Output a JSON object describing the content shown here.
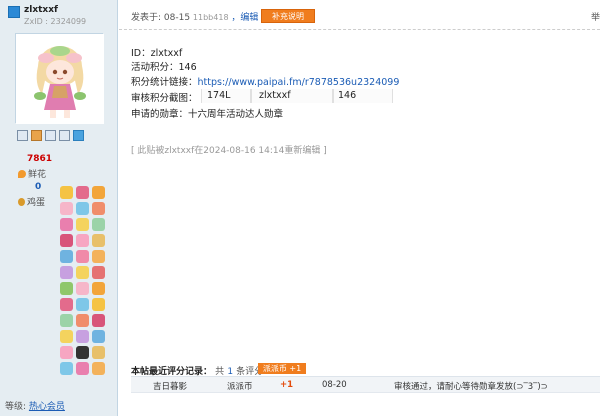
{
  "user": {
    "name": "zlxtxxf",
    "uid": "ZxID : 2324099",
    "stats": {
      "points": "7861",
      "flower_label": "鲜花",
      "zero": "0",
      "egg_label": "鸡蛋"
    },
    "level_label": "等级:",
    "level_value": "热心会员"
  },
  "post": {
    "time_prefix": "发表于: 08-15",
    "time_small": "11bb418",
    "edit_link": "，编辑",
    "supplement_button": "补充说明",
    "right_label": "举"
  },
  "content": {
    "id_line": "ID：zlxtxxf",
    "activity_line": "活动积分：146",
    "link_label": "积分统计链接：",
    "link_url": "https://www.paipai.fm/r7878536u2324099",
    "screenshot_row": {
      "label": "审核积分截图：",
      "c1": "174L",
      "c2": "zlxtxxf",
      "c3": "146"
    },
    "medal_line": "申请的勋章：十六周年活动达人勋章",
    "edited": "[ 此贴被zlxtxxf在2024-08-16 14:14重新编辑 ]"
  },
  "rating": {
    "title_prefix": "本帖最近评分记录：",
    "total_prefix": "共",
    "total_num": "1",
    "total_suffix": "条评分",
    "badge": "派派币 +1",
    "row": {
      "user": "吉日暮影",
      "type": "派派币",
      "amount": "+1",
      "date": "08-20",
      "reason": "审核通过，请耐心等待勋章发放(⊃‾3‾)⊃"
    }
  },
  "icons": [
    "message-icon",
    "add-friend-icon",
    "profile-icon",
    "card-icon",
    "chart-icon"
  ],
  "colors": {
    "accent_orange": "#f07d1e",
    "link_blue": "#1b5cb5",
    "sidebar_bg": "#e5edf2",
    "points_red": "#cc0000"
  }
}
